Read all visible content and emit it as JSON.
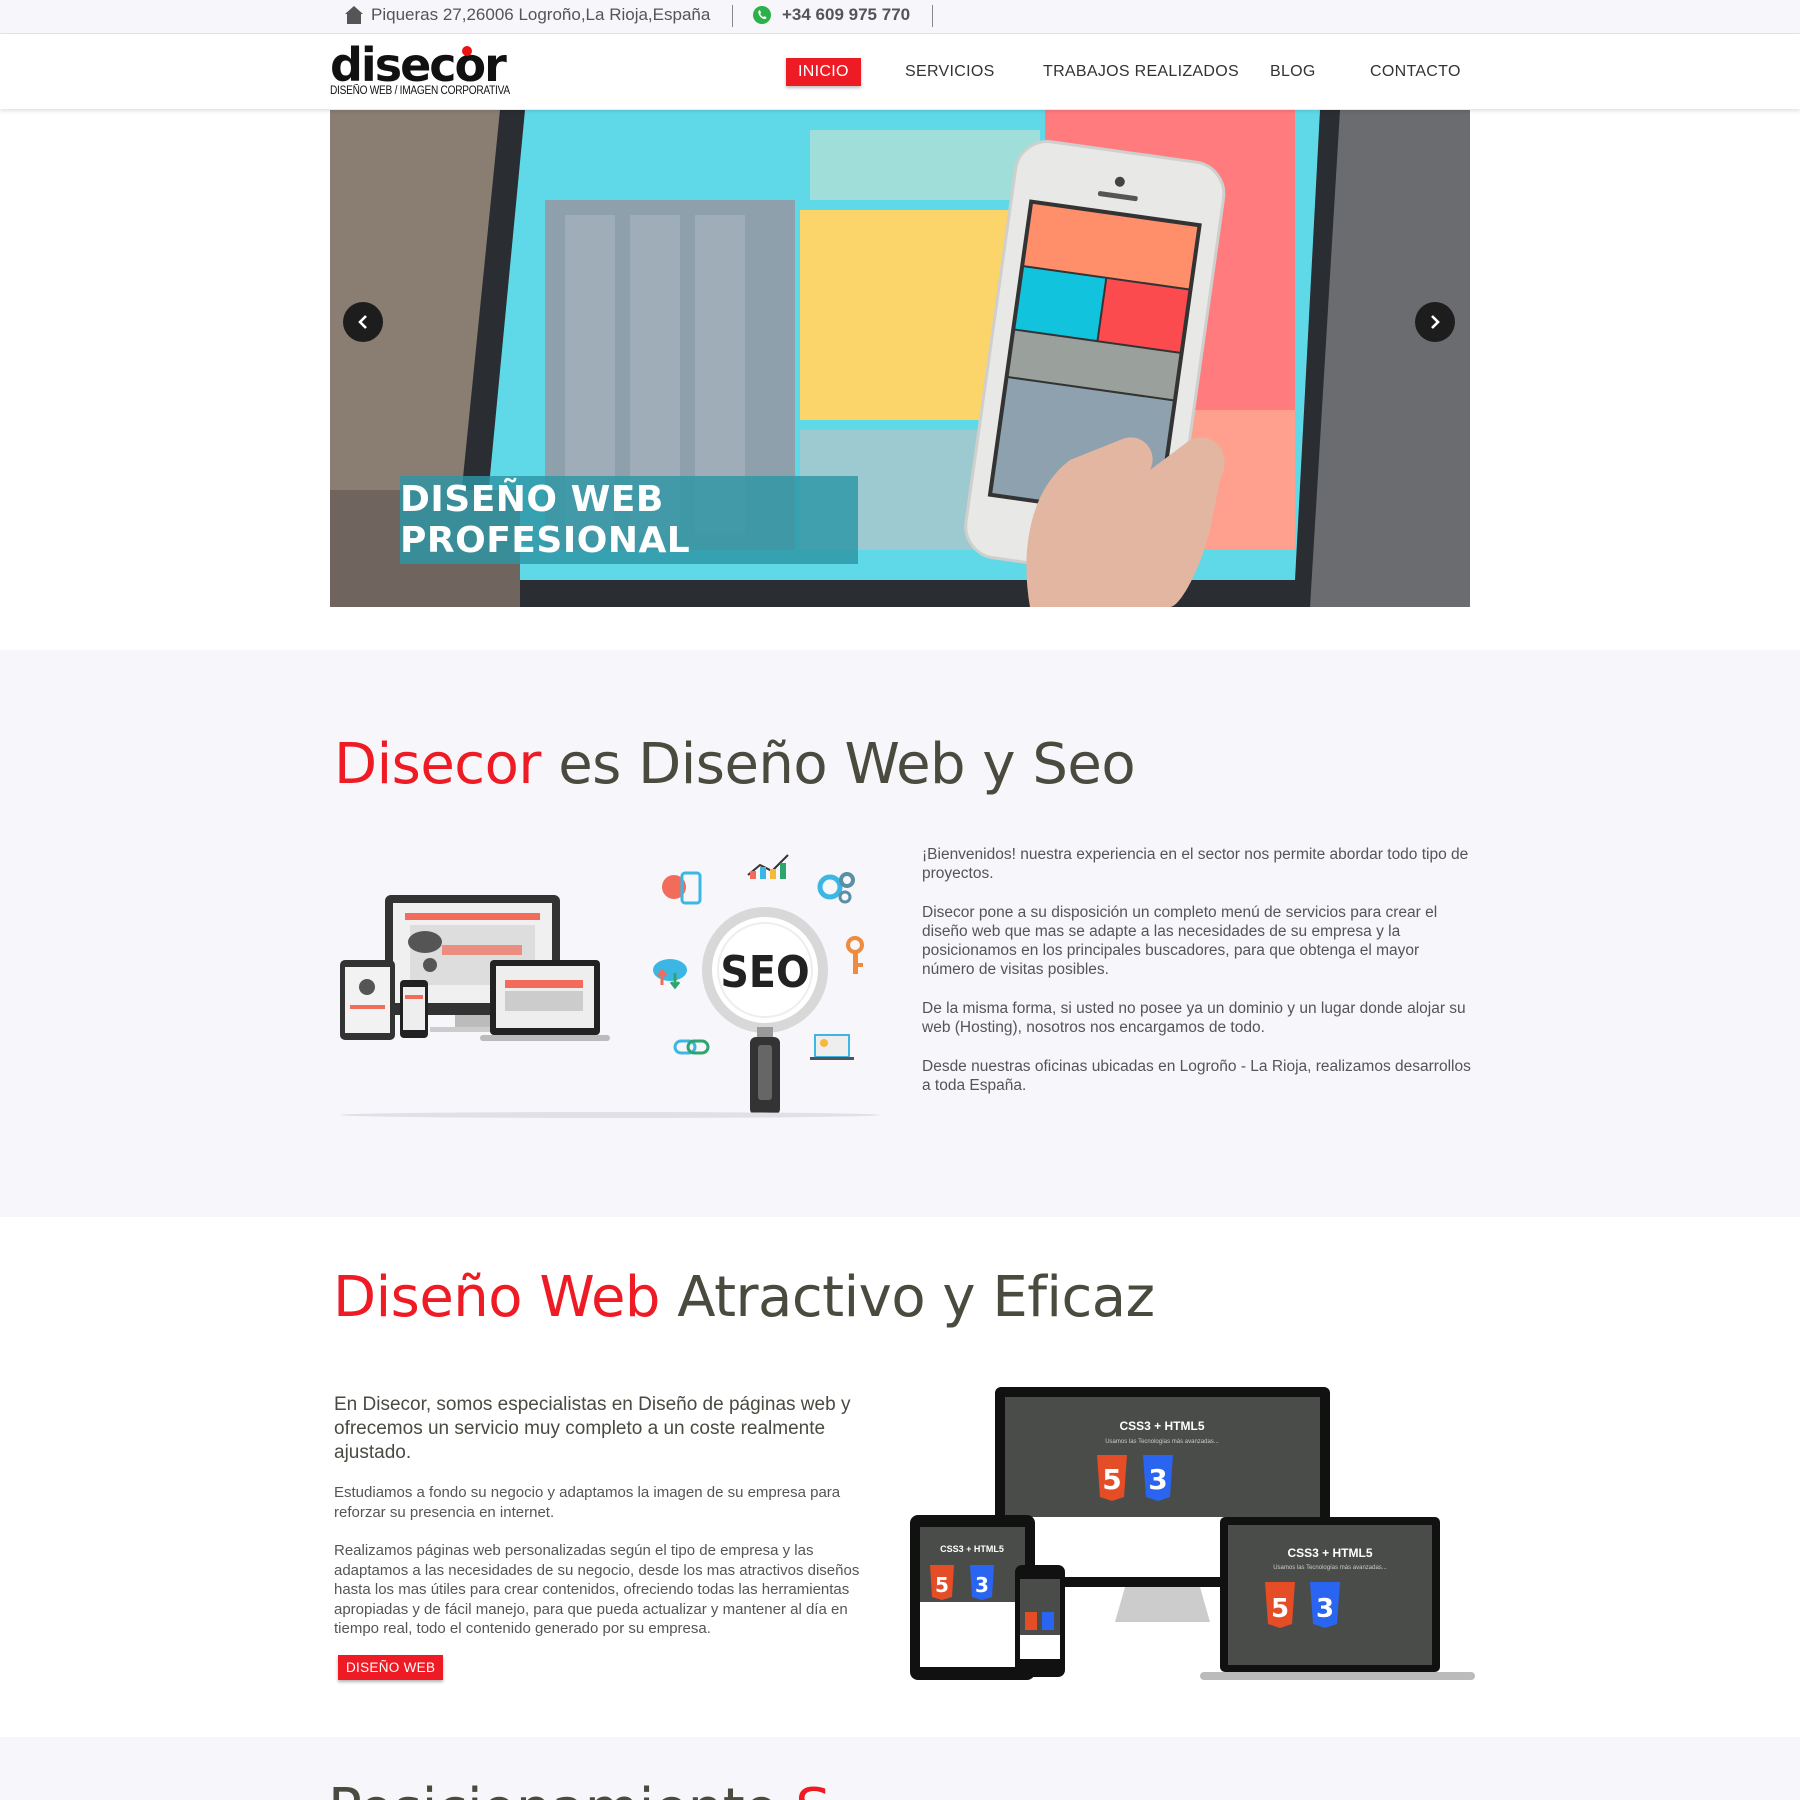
{
  "topbar": {
    "address": "Piqueras 27,26006 Logroño,La Rioja,España",
    "phone": "+34 609 975 770"
  },
  "header": {
    "logo_text": "disecor",
    "logo_tagline": "DISEÑO WEB / IMAGEN CORPORATIVA",
    "nav": [
      {
        "label": "INICIO",
        "active": true
      },
      {
        "label": "SERVICIOS",
        "active": false
      },
      {
        "label": "TRABAJOS REALIZADOS",
        "active": false
      },
      {
        "label": "BLOG",
        "active": false
      },
      {
        "label": "CONTACTO",
        "active": false
      }
    ]
  },
  "slider": {
    "caption": "DISEÑO WEB PROFESIONAL",
    "prev_icon": "chevron-left-icon",
    "next_icon": "chevron-right-icon"
  },
  "intro": {
    "title_highlight": "Disecor",
    "title_rest": " es Diseño Web y Seo",
    "illustration_label": "SEO",
    "paragraphs": [
      "¡Bienvenidos! nuestra experiencia en el sector nos permite abordar todo tipo de proyectos.",
      "Disecor pone a su disposición un completo menú de servicios para crear el diseño web que mas se adapte a las necesidades de su empresa y la posicionamos en los principales buscadores, para que obtenga el mayor número de visitas posibles.",
      "De la misma forma, si usted no posee ya un dominio y un lugar donde alojar su web (Hosting), nosotros nos encargamos de todo.",
      "Desde nuestras oficinas ubicadas en Logroño - La Rioja, realizamos desarrollos a toda España."
    ]
  },
  "webdesign": {
    "title_highlight": "Diseño Web",
    "title_rest": " Atractivo y Eficaz",
    "lead": "En Disecor, somos especialistas en Diseño de páginas web y ofrecemos un servicio muy completo a un coste realmente ajustado.",
    "paragraphs": [
      "Estudiamos a fondo su negocio y adaptamos la imagen de su empresa para reforzar su presencia en internet.",
      "Realizamos páginas web personalizadas según el tipo de empresa y las adaptamos a las necesidades de su negocio, desde los mas atractivos diseños hasta los mas útiles para crear contenidos, ofreciendo todas las herramientas apropiadas y de fácil manejo, para que pueda actualizar y mantener al día en tiempo real, todo el contenido generado por su empresa."
    ],
    "button": "DISEÑO WEB",
    "screen_title": "CSS3 + HTML5",
    "screen_subtitle": "Usamos las Tecnologías más avanzadas...",
    "badge_5": "5",
    "badge_3": "3"
  },
  "section3": {
    "title_highlight": "S",
    "title_rest": "Posicionamiento "
  },
  "colors": {
    "accent": "#ee1b24",
    "heading": "#4a4a3e",
    "caption_bg": "#2d96a5",
    "section_bg": "#f6f6fb"
  }
}
